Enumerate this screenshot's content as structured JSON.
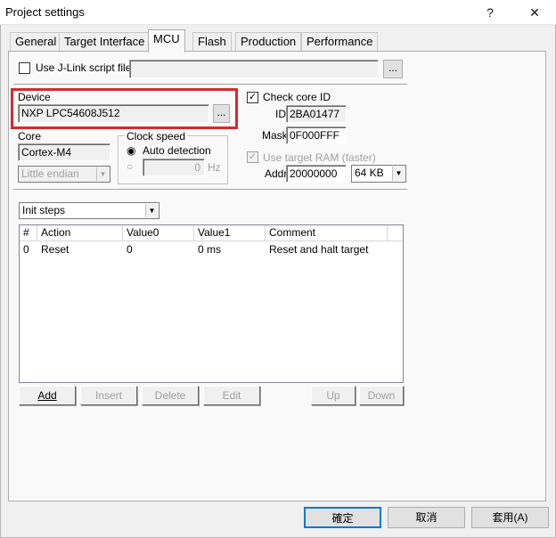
{
  "window": {
    "title": "Project settings",
    "help_glyph": "?",
    "close_glyph": "✕"
  },
  "tabs": [
    {
      "label": "General"
    },
    {
      "label": "Target Interface"
    },
    {
      "label": "MCU"
    },
    {
      "label": "Flash"
    },
    {
      "label": "Production"
    },
    {
      "label": "Performance"
    }
  ],
  "jlink_script": {
    "label": "Use J-Link script file",
    "checked": false,
    "value": "",
    "browse_label": "..."
  },
  "device": {
    "group_label": "Device",
    "value": "NXP LPC54608J512",
    "browse_label": "...",
    "highlight_color": "#d62a2f"
  },
  "check_core_id": {
    "label": "Check core ID",
    "checkmark": "✓",
    "id_label": "ID",
    "id_value": "2BA01477",
    "mask_label": "Mask",
    "mask_value": "0F000FFF"
  },
  "core": {
    "label": "Core",
    "value": "Cortex-M4",
    "endian": "Little endian"
  },
  "clock_speed": {
    "label": "Clock speed",
    "auto_label": "Auto detection",
    "manual_value": "0",
    "unit": "Hz"
  },
  "target_ram": {
    "label": "Use target RAM (faster)",
    "checkmark": "✓",
    "addr_label": "Addr",
    "addr_value": "20000000",
    "size_value": "64 KB"
  },
  "steps": {
    "selector": "Init steps",
    "columns": [
      "#",
      "Action",
      "Value0",
      "Value1",
      "Comment"
    ],
    "rows": [
      {
        "num": "0",
        "action": "Reset",
        "value0": "0",
        "value1": "0 ms",
        "comment": "Reset and halt target"
      }
    ]
  },
  "step_buttons": {
    "add": "Add",
    "insert": "Insert",
    "delete": "Delete",
    "edit": "Edit",
    "up": "Up",
    "down": "Down"
  },
  "footer": {
    "ok": "確定",
    "cancel": "取消",
    "apply": "套用(A)"
  }
}
